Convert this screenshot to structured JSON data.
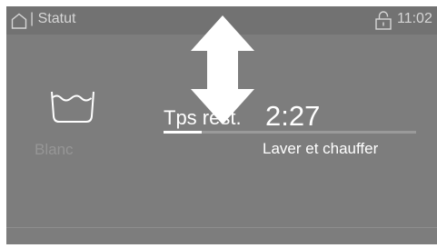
{
  "statusbar": {
    "home_icon": "home-icon",
    "separator": "|",
    "title": "Statut",
    "lock_icon": "lock-icon",
    "time": "11:02"
  },
  "program": {
    "icon": "wash-basin-icon",
    "name": "Blanc"
  },
  "remaining": {
    "label": "Tps rest.",
    "value": "2:27"
  },
  "progress": {
    "fraction": 0.15
  },
  "phase": "Laver et chauffer",
  "gesture": {
    "icon": "vertical-swipe-arrow-icon"
  },
  "colors": {
    "screen_bg": "#7d7d7d",
    "statusbar_bg": "#727272",
    "text": "#ffffff",
    "muted_text": "#969696"
  }
}
